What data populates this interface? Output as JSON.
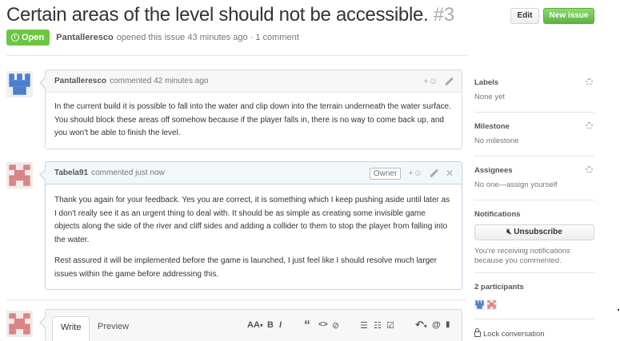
{
  "issue": {
    "title": "Certain areas of the level should not be accessible.",
    "number": "#3",
    "state": "Open",
    "author": "Pantalleresco",
    "meta_text": "opened this issue 43 minutes ago · 1 comment"
  },
  "header_buttons": {
    "edit": "Edit",
    "new_issue": "New issue"
  },
  "comments": [
    {
      "author": "Pantalleresco",
      "time": "commented 42 minutes ago",
      "body": [
        "In the current build it is possible to fall into the water and clip down into the terrain underneath the water surface. You should block these areas off somehow because if the player falls in, there is no way to come back up, and you won't be able to finish the level."
      ]
    },
    {
      "author": "Tabela91",
      "time": "commented just now",
      "badge": "Owner",
      "body": [
        "Thank you again for your feedback. Yes you are correct, it is something which I keep pushing aside until later as I don't really see it as an urgent thing to deal with. It should be as simple as creating some invisible game objects along the side of the river and cliff sides and adding a collider to them to stop the player from falling into the water.",
        "Rest assured it will be implemented before the game is launched, I just feel like I should resolve much larger issues within the game before addressing this."
      ]
    }
  ],
  "editor": {
    "tabs": [
      "Write",
      "Preview"
    ],
    "toolbar": {
      "heading": "AA",
      "bold": "B",
      "italic": "I",
      "quote": "“",
      "code": "<>",
      "link": "⊘",
      "bullets": "☰",
      "numbers": "☷",
      "tasks": "☑",
      "reply": "↶",
      "mention": "@",
      "bookmark": "▮"
    }
  },
  "sidebar": {
    "labels": {
      "heading": "Labels",
      "value": "None yet"
    },
    "milestone": {
      "heading": "Milestone",
      "value": "No milestone"
    },
    "assignees": {
      "heading": "Assignees",
      "value": "No one—assign yourself"
    },
    "notifications": {
      "heading": "Notifications",
      "button": "Unsubscribe",
      "note": "You're receiving notifications because you commented."
    },
    "participants": {
      "heading": "2 participants"
    },
    "lock": "Lock conversation"
  },
  "colors": {
    "open_green": "#6cc644",
    "new_issue_green": "#60b044",
    "avatar_blue": "#4a7fd0",
    "avatar_red": "#d98585"
  }
}
